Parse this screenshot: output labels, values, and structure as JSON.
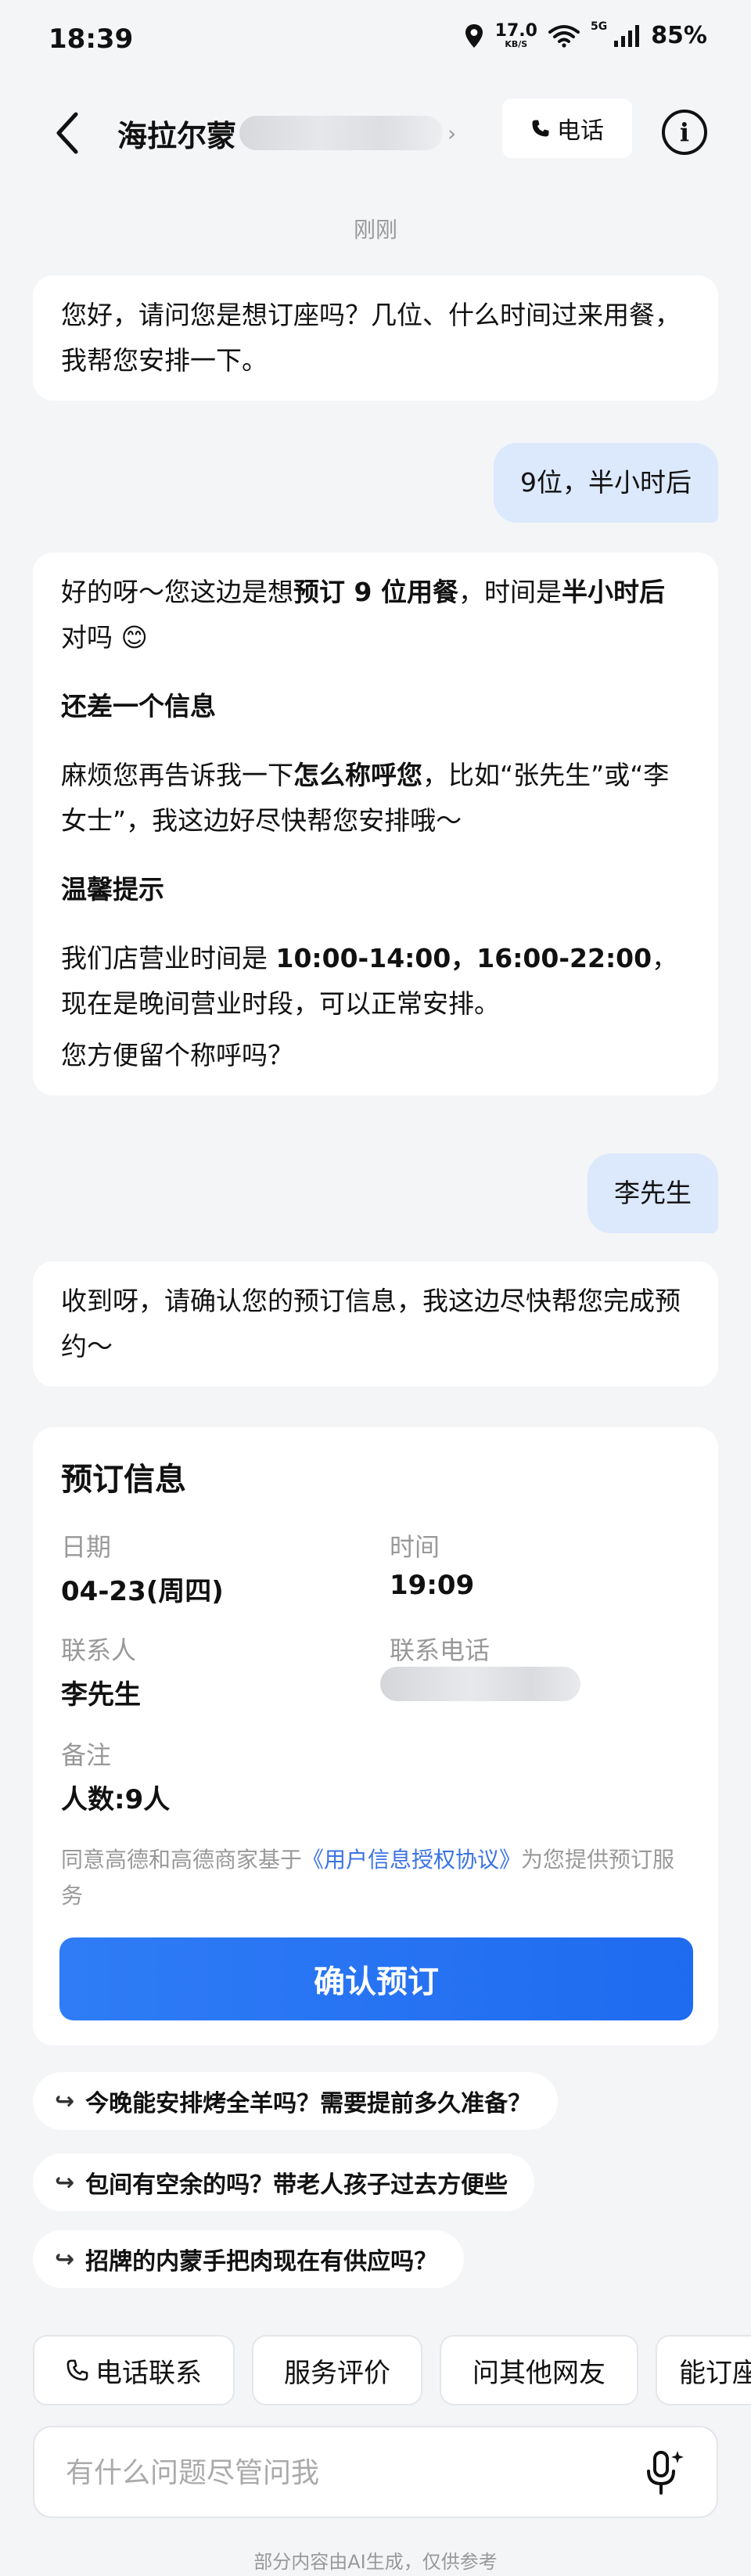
{
  "status_bar": {
    "time": "18:39",
    "net_speed": "17.0",
    "net_unit": "KB/S",
    "network_type": "5G",
    "battery": "85%"
  },
  "header": {
    "shop_name": "海拉尔蒙",
    "call_label": "电话"
  },
  "timestamp": "刚刚",
  "messages": {
    "m1": "您好，请问您是想订座吗？几位、什么时间过来用餐，我帮您安排一下。",
    "m2_user": "9位，半小时后",
    "m3": {
      "p1_a": "好的呀～您这边是想",
      "p1_b": "预订 9 位用餐",
      "p1_c": "，时间是",
      "p1_d": "半小时后",
      "p1_e": "对吗 😊",
      "h1": "还差一个信息",
      "p2_a": "麻烦您再告诉我一下",
      "p2_b": "怎么称呼您",
      "p2_c": "，比如“张先生”或“李女士”，我这边好尽快帮您安排哦～",
      "h2": "温馨提示",
      "p3_a": "我们店营业时间是 ",
      "p3_b": "10:00-14:00，16:00-22:00",
      "p3_c": "，现在是晚间营业时段，可以正常安排。",
      "p4": "您方便留个称呼吗？"
    },
    "m4_user": "李先生",
    "m5": "收到呀，请确认您的预订信息，我这边尽快帮您完成预约～"
  },
  "booking": {
    "title": "预订信息",
    "date_label": "日期",
    "date_value": "04-23(周四)",
    "time_label": "时间",
    "time_value": "19:09",
    "contact_label": "联系人",
    "contact_value": "李先生",
    "phone_label": "联系电话",
    "remark_label": "备注",
    "remark_value": "人数:9人",
    "consent_a": "同意高德和高德商家基于",
    "consent_link": "《用户信息授权协议》",
    "consent_b": "为您提供预订服务",
    "confirm_label": "确认预订"
  },
  "suggestions": [
    "今晚能安排烤全羊吗？需要提前多久准备？",
    "包间有空余的吗？带老人孩子过去方便些",
    "招牌的内蒙手把肉现在有供应吗？"
  ],
  "quick_actions": [
    "电话联系",
    "服务评价",
    "问其他网友",
    "能订座"
  ],
  "input": {
    "placeholder": "有什么问题尽管问我"
  },
  "footer_note": "部分内容由AI生成，仅供参考",
  "colors": {
    "accent": "#1f6bf0",
    "user_bubble": "#dce8fb",
    "background": "#f4f5f7"
  }
}
